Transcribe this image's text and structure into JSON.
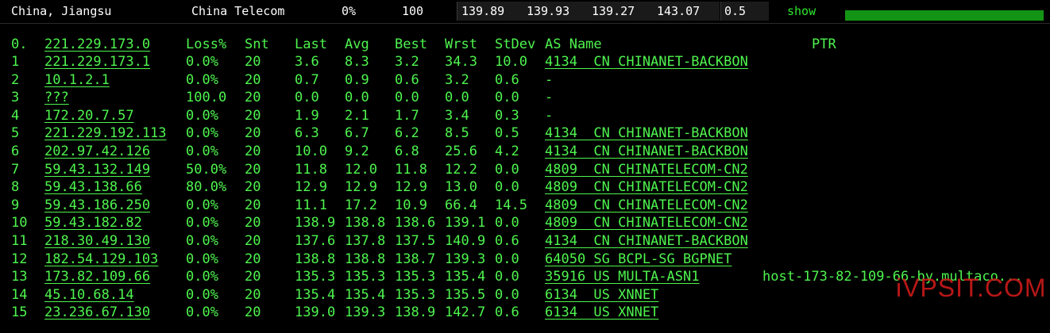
{
  "summary": {
    "location": "China, Jiangsu",
    "isp": "China Telecom",
    "loss": "0%",
    "sent": "100",
    "last": "139.89",
    "avg": "139.93",
    "best": "139.27",
    "worst": "143.07",
    "stdev": "0.5",
    "show_label": "show",
    "progress_fraction": 1.0,
    "progress_color": "#149414"
  },
  "headers": {
    "index": "0.",
    "host": "221.229.173.0",
    "loss": "Loss%",
    "snt": "Snt",
    "last": "Last",
    "avg": "Avg",
    "best": "Best",
    "wrst": "Wrst",
    "stdev": "StDev",
    "as_name": "AS Name",
    "ptr": "PTR"
  },
  "hops": [
    {
      "idx": "1",
      "host": "221.229.173.1",
      "loss": "0.0%",
      "snt": "20",
      "last": "3.6",
      "avg": "8.3",
      "best": "3.2",
      "wrst": "34.3",
      "stdev": "10.0",
      "as": "4134  CN CHINANET-BACKBON",
      "ptr": ""
    },
    {
      "idx": "2",
      "host": "10.1.2.1",
      "loss": "0.0%",
      "snt": "20",
      "last": "0.7",
      "avg": "0.9",
      "best": "0.6",
      "wrst": "3.2",
      "stdev": "0.6",
      "as": "-",
      "ptr": ""
    },
    {
      "idx": "3",
      "host": "???",
      "loss": "100.0",
      "snt": "20",
      "last": "0.0",
      "avg": "0.0",
      "best": "0.0",
      "wrst": "0.0",
      "stdev": "0.0",
      "as": "-",
      "ptr": ""
    },
    {
      "idx": "4",
      "host": "172.20.7.57",
      "loss": "0.0%",
      "snt": "20",
      "last": "1.9",
      "avg": "2.1",
      "best": "1.7",
      "wrst": "3.4",
      "stdev": "0.3",
      "as": "-",
      "ptr": ""
    },
    {
      "idx": "5",
      "host": "221.229.192.113",
      "loss": "0.0%",
      "snt": "20",
      "last": "6.3",
      "avg": "6.7",
      "best": "6.2",
      "wrst": "8.5",
      "stdev": "0.5",
      "as": "4134  CN CHINANET-BACKBON",
      "ptr": ""
    },
    {
      "idx": "6",
      "host": "202.97.42.126",
      "loss": "0.0%",
      "snt": "20",
      "last": "10.0",
      "avg": "9.2",
      "best": "6.8",
      "wrst": "25.6",
      "stdev": "4.2",
      "as": "4134  CN CHINANET-BACKBON",
      "ptr": ""
    },
    {
      "idx": "7",
      "host": "59.43.132.149",
      "loss": "50.0%",
      "snt": "20",
      "last": "11.8",
      "avg": "12.0",
      "best": "11.8",
      "wrst": "12.2",
      "stdev": "0.0",
      "as": "4809  CN CHINATELECOM-CN2",
      "ptr": ""
    },
    {
      "idx": "8",
      "host": "59.43.138.66",
      "loss": "80.0%",
      "snt": "20",
      "last": "12.9",
      "avg": "12.9",
      "best": "12.9",
      "wrst": "13.0",
      "stdev": "0.0",
      "as": "4809  CN CHINATELECOM-CN2",
      "ptr": ""
    },
    {
      "idx": "9",
      "host": "59.43.186.250",
      "loss": "0.0%",
      "snt": "20",
      "last": "11.1",
      "avg": "17.2",
      "best": "10.9",
      "wrst": "66.4",
      "stdev": "14.5",
      "as": "4809  CN CHINATELECOM-CN2",
      "ptr": ""
    },
    {
      "idx": "10",
      "host": "59.43.182.82",
      "loss": "0.0%",
      "snt": "20",
      "last": "138.9",
      "avg": "138.8",
      "best": "138.6",
      "wrst": "139.1",
      "stdev": "0.0",
      "as": "4809  CN CHINATELECOM-CN2",
      "ptr": ""
    },
    {
      "idx": "11",
      "host": "218.30.49.130",
      "loss": "0.0%",
      "snt": "20",
      "last": "137.6",
      "avg": "137.8",
      "best": "137.5",
      "wrst": "140.9",
      "stdev": "0.6",
      "as": "4134  CN CHINANET-BACKBON",
      "ptr": ""
    },
    {
      "idx": "12",
      "host": "182.54.129.103",
      "loss": "0.0%",
      "snt": "20",
      "last": "138.8",
      "avg": "138.8",
      "best": "138.7",
      "wrst": "139.3",
      "stdev": "0.0",
      "as": "64050 SG BCPL-SG BGPNET",
      "ptr": ""
    },
    {
      "idx": "13",
      "host": "173.82.109.66",
      "loss": "0.0%",
      "snt": "20",
      "last": "135.3",
      "avg": "135.3",
      "best": "135.3",
      "wrst": "135.4",
      "stdev": "0.0",
      "as": "35916 US MULTA-ASN1",
      "ptr": "host-173-82-109-66-by.multaco..."
    },
    {
      "idx": "14",
      "host": "45.10.68.14",
      "loss": "0.0%",
      "snt": "20",
      "last": "135.4",
      "avg": "135.4",
      "best": "135.3",
      "wrst": "135.5",
      "stdev": "0.0",
      "as": "6134  US XNNET",
      "ptr": ""
    },
    {
      "idx": "15",
      "host": "23.236.67.130",
      "loss": "0.0%",
      "snt": "20",
      "last": "139.0",
      "avg": "139.3",
      "best": "138.9",
      "wrst": "142.7",
      "stdev": "0.6",
      "as": "6134  US XNNET",
      "ptr": ""
    }
  ],
  "watermark": "iVPSIT.COM"
}
